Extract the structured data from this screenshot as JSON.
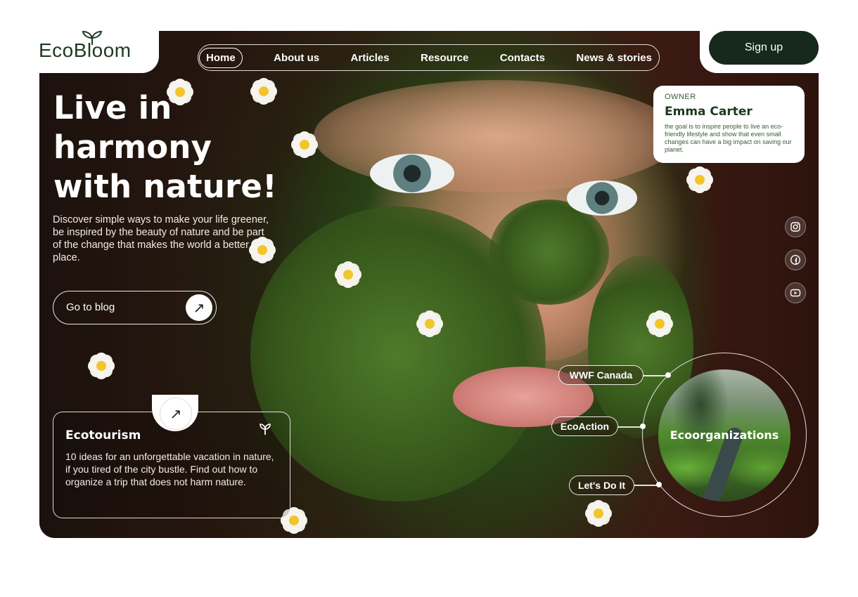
{
  "brand": {
    "logo_text": "EcoBloom"
  },
  "nav": {
    "items": [
      {
        "label": "Home",
        "active": true
      },
      {
        "label": "About us"
      },
      {
        "label": "Articles"
      },
      {
        "label": "Resource"
      },
      {
        "label": "Contacts"
      },
      {
        "label": "News & stories"
      }
    ]
  },
  "header": {
    "signup_label": "Sign up"
  },
  "hero": {
    "title_lines": [
      "Live in",
      "harmony",
      "with nature!"
    ],
    "lead": "Discover simple ways to make your life greener, be inspired by the beauty of nature and be part of the change that makes the world a better place.",
    "cta_label": "Go to blog",
    "cta_icon": "arrow-up-right-icon"
  },
  "ecotourism": {
    "title": "Ecotourism",
    "text": "10 ideas for an unforgettable vacation in nature, if you tired of the city bustle. Find out how to organize a trip that does not harm nature.",
    "icon": "sprout-icon"
  },
  "owner": {
    "role": "OWNER",
    "name": "Emma Carter",
    "description": "the goal is to inspire people to live an eco-friendly lifestyle and show that even small changes can have a big impact on saving our planet."
  },
  "social": [
    "instagram-icon",
    "facebook-icon",
    "youtube-icon"
  ],
  "organizations": {
    "label": "Ecoorganizations",
    "links": [
      "WWF Canada",
      "EcoAction",
      "Let's Do It"
    ]
  },
  "colors": {
    "brand_dark": "#16291a",
    "brand_green": "#1f3a22",
    "hero_bg": "#2a120c"
  }
}
